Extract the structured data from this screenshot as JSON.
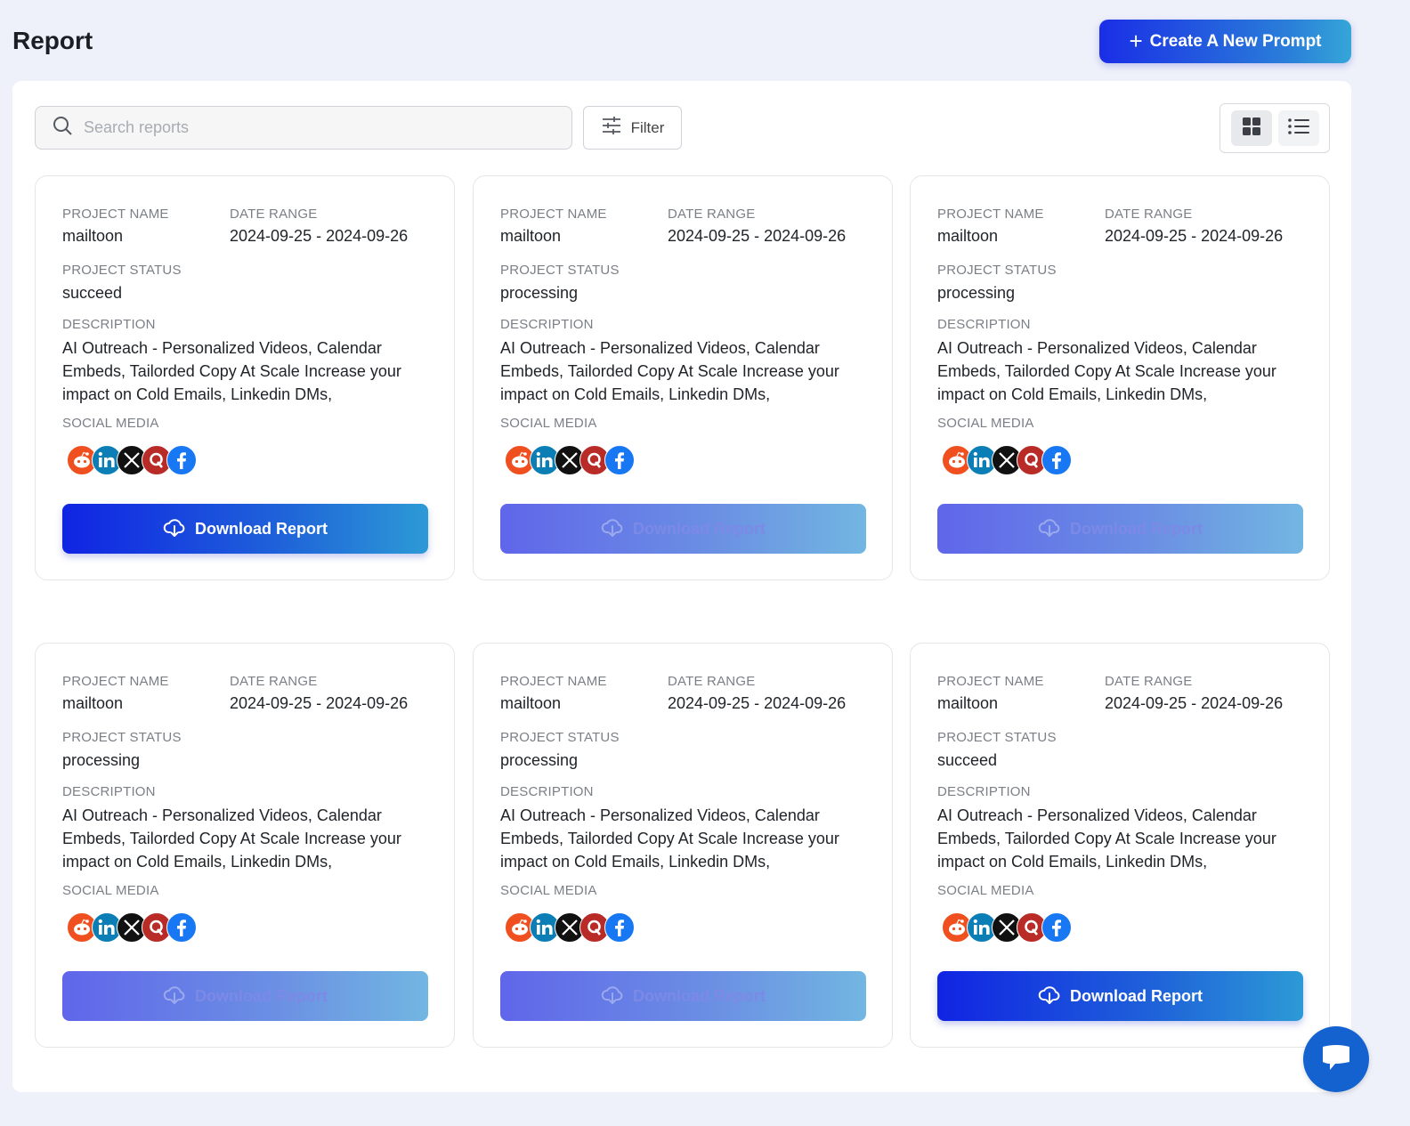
{
  "header": {
    "title": "Report",
    "create_button_label": "Create A New Prompt"
  },
  "toolbar": {
    "search_placeholder": "Search reports",
    "search_value": "",
    "filter_label": "Filter",
    "view_mode": "grid"
  },
  "labels": {
    "project_name": "PROJECT NAME",
    "date_range": "DATE RANGE",
    "project_status": "PROJECT STATUS",
    "description": "DESCRIPTION",
    "social_media": "SOCIAL MEDIA",
    "download": "Download Report"
  },
  "social_icons": [
    "reddit-icon",
    "linkedin-icon",
    "x-icon",
    "quora-icon",
    "facebook-icon"
  ],
  "colors": {
    "reddit": "#f0501f",
    "linkedin": "#0b7fb5",
    "x": "#111111",
    "quora": "#b92b27",
    "facebook": "#1877f2",
    "accent": "#1a2ee6"
  },
  "reports": [
    {
      "project_name": "mailtoon",
      "date_range": "2024-09-25 - 2024-09-26",
      "status": "succeed",
      "description": "AI Outreach - Personalized Videos, Calendar Embeds, Tailorded Copy At Scale Increase your impact on Cold Emails, Linkedin DMs,",
      "download_enabled": true
    },
    {
      "project_name": "mailtoon",
      "date_range": "2024-09-25 - 2024-09-26",
      "status": "processing",
      "description": "AI Outreach - Personalized Videos, Calendar Embeds, Tailorded Copy At Scale Increase your impact on Cold Emails, Linkedin DMs,",
      "download_enabled": false
    },
    {
      "project_name": "mailtoon",
      "date_range": "2024-09-25 - 2024-09-26",
      "status": "processing",
      "description": "AI Outreach - Personalized Videos, Calendar Embeds, Tailorded Copy At Scale Increase your impact on Cold Emails, Linkedin DMs,",
      "download_enabled": false
    },
    {
      "project_name": "mailtoon",
      "date_range": "2024-09-25 - 2024-09-26",
      "status": "processing",
      "description": "AI Outreach - Personalized Videos, Calendar Embeds, Tailorded Copy At Scale Increase your impact on Cold Emails, Linkedin DMs,",
      "download_enabled": false
    },
    {
      "project_name": "mailtoon",
      "date_range": "2024-09-25 - 2024-09-26",
      "status": "processing",
      "description": "AI Outreach - Personalized Videos, Calendar Embeds, Tailorded Copy At Scale Increase your impact on Cold Emails, Linkedin DMs,",
      "download_enabled": false
    },
    {
      "project_name": "mailtoon",
      "date_range": "2024-09-25 - 2024-09-26",
      "status": "succeed",
      "description": "AI Outreach - Personalized Videos, Calendar Embeds, Tailorded Copy At Scale Increase your impact on Cold Emails, Linkedin DMs,",
      "download_enabled": true
    }
  ]
}
